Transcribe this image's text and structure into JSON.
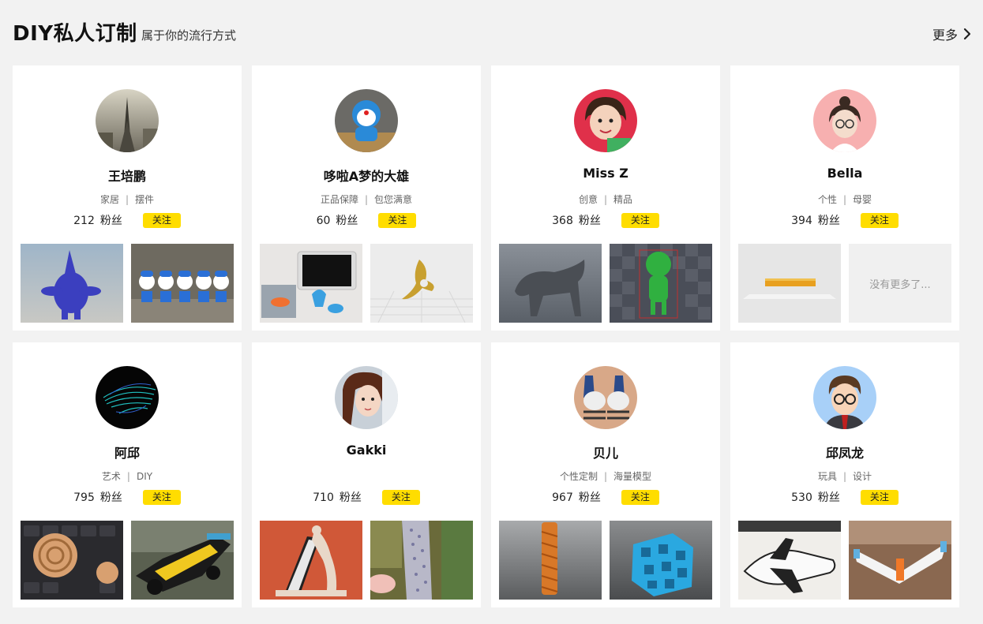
{
  "header": {
    "title": "DIY私人订制",
    "subtitle": "属于你的流行方式",
    "more_label": "更多"
  },
  "follow_label": "关注",
  "fans_unit": "粉丝",
  "designers": [
    {
      "name": "王培鹏",
      "tags": [
        "家居",
        "摆件"
      ],
      "fans": "212"
    },
    {
      "name": "哆啦A梦的大雄",
      "tags": [
        "正品保障",
        "包您满意"
      ],
      "fans": "60"
    },
    {
      "name": "Miss Z",
      "tags": [
        "创意",
        "精品"
      ],
      "fans": "368"
    },
    {
      "name": "Bella",
      "tags": [
        "个性",
        "母婴"
      ],
      "fans": "394",
      "empty_thumb_text": "没有更多了..."
    },
    {
      "name": "阿邱",
      "tags": [
        "艺术",
        "DIY"
      ],
      "fans": "795"
    },
    {
      "name": "Gakki",
      "tags": [],
      "fans": "710"
    },
    {
      "name": "贝儿",
      "tags": [
        "个性定制",
        "海量模型"
      ],
      "fans": "967"
    },
    {
      "name": "邱凤龙",
      "tags": [
        "玩具",
        "设计"
      ],
      "fans": "530"
    }
  ],
  "colors": {
    "accent": "#ffdd00",
    "page_bg": "#f2f2f2",
    "card_bg": "#ffffff"
  }
}
